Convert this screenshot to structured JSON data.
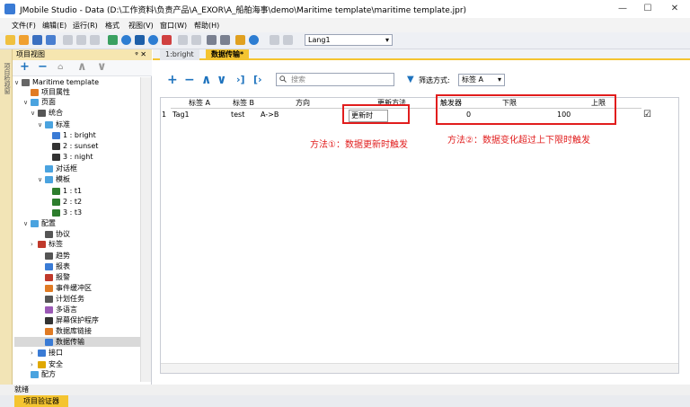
{
  "window": {
    "title": "JMobile Studio - Data (D:\\工作资料\\负责产品\\A_EXOR\\A_船舶海事\\demo\\Maritime template\\maritime template.jpr)",
    "minimize": "—",
    "maximize": "☐",
    "close": "✕"
  },
  "menu": [
    "文件(F)",
    "编辑(E)",
    "运行(R)",
    "格式",
    "视图(V)",
    "窗口(W)",
    "帮助(H)"
  ],
  "toolbar": {
    "lang": "Lang1"
  },
  "left_strip": {
    "label": "项目检视窗"
  },
  "panel": {
    "title": "项目视图",
    "pin": "ᵠ ✕",
    "tools": [
      "+",
      "−",
      "⌂",
      "∧",
      "∨"
    ],
    "tree": [
      {
        "label": "Maritime template",
        "icon": "document-icon",
        "color": "#666666"
      },
      {
        "label": "项目属性",
        "icon": "properties-icon",
        "color": "#e07b24"
      },
      {
        "label": "页面",
        "icon": "folder-icon",
        "color": "#4aa3df"
      },
      {
        "label": "统合",
        "icon": "page-icon",
        "color": "#555555"
      },
      {
        "label": "标准",
        "icon": "folder-icon",
        "color": "#4aa3df"
      },
      {
        "label": "1 : bright",
        "icon": "gear-icon",
        "color": "#3a7bd5"
      },
      {
        "label": "2 : sunset",
        "icon": "page-icon",
        "color": "#333333"
      },
      {
        "label": "3 : night",
        "icon": "page-icon",
        "color": "#333333"
      },
      {
        "label": "对话框",
        "icon": "folder-icon",
        "color": "#4aa3df"
      },
      {
        "label": "模板",
        "icon": "folder-icon",
        "color": "#4aa3df"
      },
      {
        "label": "1 : t1",
        "icon": "template-icon",
        "color": "#2d7d2d"
      },
      {
        "label": "2 : t2",
        "icon": "template-icon",
        "color": "#2d7d2d"
      },
      {
        "label": "3 : t3",
        "icon": "template-icon",
        "color": "#2d7d2d"
      },
      {
        "label": "配置",
        "icon": "folder-icon",
        "color": "#4aa3df"
      },
      {
        "label": "协议",
        "icon": "protocol-icon",
        "color": "#555555"
      },
      {
        "label": "标签",
        "icon": "tag-icon",
        "color": "#c0392b"
      },
      {
        "label": "趋势",
        "icon": "trend-icon",
        "color": "#555555"
      },
      {
        "label": "报表",
        "icon": "report-icon",
        "color": "#3a7bd5"
      },
      {
        "label": "报警",
        "icon": "alarm-icon",
        "color": "#c0392b"
      },
      {
        "label": "事件缓冲区",
        "icon": "event-icon",
        "color": "#e07b24"
      },
      {
        "label": "计划任务",
        "icon": "schedule-icon",
        "color": "#555555"
      },
      {
        "label": "多语言",
        "icon": "language-icon",
        "color": "#9b59b6"
      },
      {
        "label": "屏幕保护程序",
        "icon": "screensaver-icon",
        "color": "#333333"
      },
      {
        "label": "数据库链接",
        "icon": "database-icon",
        "color": "#e07b24"
      },
      {
        "label": "数据传输",
        "icon": "transfer-icon",
        "color": "#3a7bd5"
      },
      {
        "label": "接口",
        "icon": "interface-icon",
        "color": "#3a7bd5"
      },
      {
        "label": "安全",
        "icon": "security-icon",
        "color": "#e0a800"
      },
      {
        "label": "配方",
        "icon": "folder-icon",
        "color": "#4aa3df"
      }
    ]
  },
  "tabs": [
    {
      "label": "1:bright"
    },
    {
      "label": "数据传输*"
    }
  ],
  "editor": {
    "search_placeholder": "搜索",
    "filter_label": "筛选方式:",
    "filter_value": "标签 A"
  },
  "grid": {
    "headers": [
      "标签 A",
      "标签 B",
      "方向",
      "更新方法",
      "触发器",
      "下限",
      "上限"
    ],
    "row": {
      "num": "1",
      "tag_a": "Tag1",
      "tag_b": "test",
      "direction": "A->B",
      "update_method": "更新时",
      "trigger": "",
      "low": "0",
      "high": "100",
      "checked": "☑"
    }
  },
  "annotations": {
    "method1": "方法①：数据更新时触发",
    "method2": "方法②：数据变化超过上下限时触发"
  },
  "status": {
    "text": "就绪",
    "bottom_tab": "项目验证器"
  },
  "colors": {
    "accent": "#f4c430",
    "highlight": "#e11d1d",
    "toolbar_blue": "#1e73be"
  }
}
